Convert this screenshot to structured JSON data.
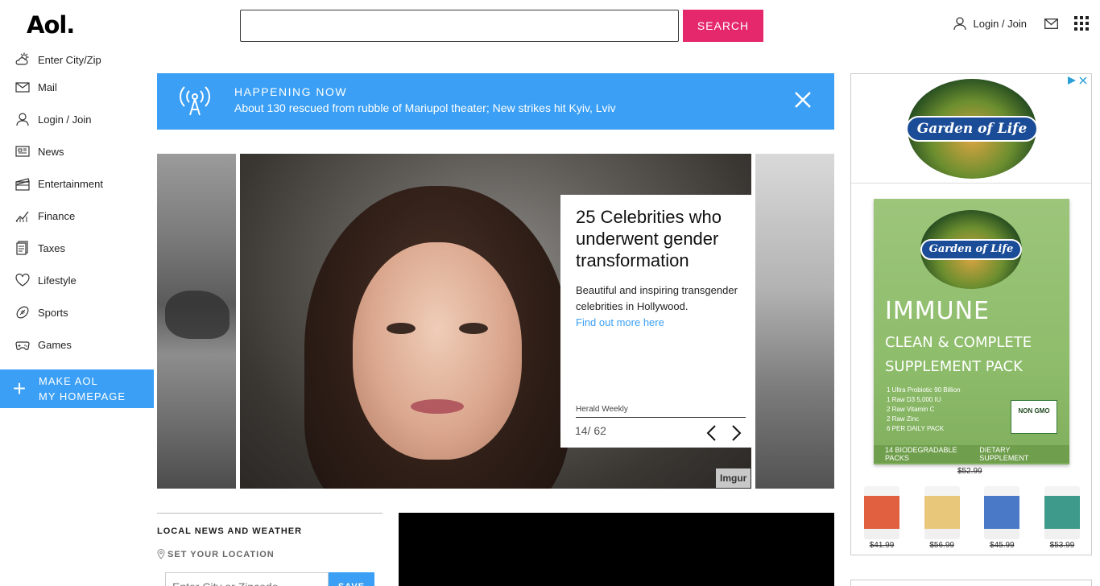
{
  "header": {
    "logo": "Aol.",
    "search_value": "",
    "search_button": "SEARCH",
    "login_label": "Login / Join"
  },
  "sidebar": {
    "items": [
      {
        "label": "Enter City/Zip",
        "icon": "weather-icon"
      },
      {
        "label": "Mail",
        "icon": "mail-icon"
      },
      {
        "label": "Login / Join",
        "icon": "user-icon"
      },
      {
        "label": "News",
        "icon": "news-icon"
      },
      {
        "label": "Entertainment",
        "icon": "entertainment-icon"
      },
      {
        "label": "Finance",
        "icon": "finance-icon"
      },
      {
        "label": "Taxes",
        "icon": "taxes-icon"
      },
      {
        "label": "Lifestyle",
        "icon": "heart-icon"
      },
      {
        "label": "Sports",
        "icon": "sports-icon"
      },
      {
        "label": "Games",
        "icon": "games-icon"
      }
    ],
    "make_home_line1": "MAKE AOL",
    "make_home_line2": "MY HOMEPAGE"
  },
  "happening": {
    "title": "HAPPENING NOW",
    "text": "About 130 rescued from rubble of Mariupol theater; New strikes hit Kyiv, Lviv"
  },
  "slideshow": {
    "headline": "25 Celebrities who underwent gender transformation",
    "description": "Beautiful and inspiring transgender celebrities in Hollywood.",
    "link": "Find out more here",
    "source": "Herald Weekly",
    "counter": "14/ 62",
    "credit": "Imgur"
  },
  "local": {
    "title": "LOCAL NEWS AND WEATHER",
    "set_location": "SET YOUR LOCATION",
    "input_placeholder": "Enter City or Zipcode",
    "save_button": "SAVE"
  },
  "ad": {
    "brand": "Garden of Life",
    "pack_brand": "Garden of Life",
    "pack_title": "IMMUNE",
    "pack_line1": "CLEAN & COMPLETE",
    "pack_line2": "SUPPLEMENT PACK",
    "pack_list": [
      "1 Ultra Probiotic 90 Billion",
      "1 Raw D3 5,000 IU",
      "2 Raw Vitamin C",
      "2 Raw Zinc",
      "6 PER DAILY PACK"
    ],
    "pack_count": "14 BIODEGRADABLE PACKS",
    "pack_type": "DIETARY SUPPLEMENT",
    "nongmo": "NON GMO",
    "main_price": "$52.99",
    "products": [
      {
        "price": "$41.99",
        "color": "#e06040"
      },
      {
        "price": "$56.99",
        "color": "#e8c77a"
      },
      {
        "price": "$45.99",
        "color": "#4a79c8"
      },
      {
        "price": "$53.99",
        "color": "#3e9a8a"
      }
    ]
  },
  "colors": {
    "accent_pink": "#e5286b",
    "accent_blue": "#3a9ff5"
  }
}
